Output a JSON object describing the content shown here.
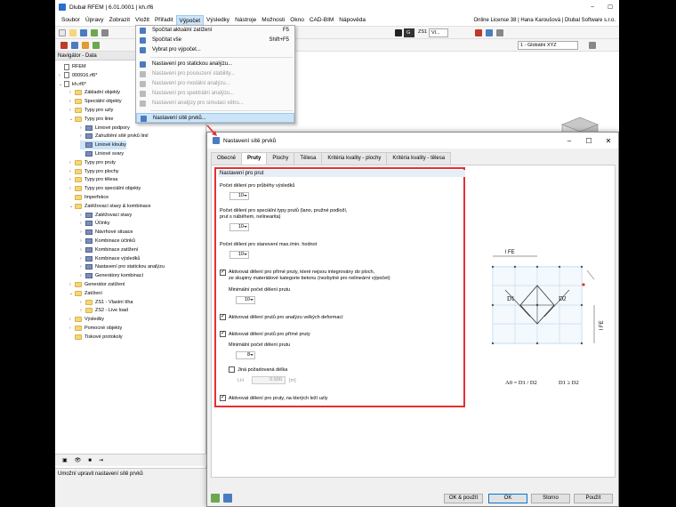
{
  "app": {
    "title": "Dlubal RFEM | 6.01.0001 | kh.rf6",
    "license": "Online License 38 | Hana Karoušová | Dlubal Software s.r.o."
  },
  "menu": [
    "Soubor",
    "Úpravy",
    "Zobrazit",
    "Vložit",
    "Přiřadit",
    "Výpočet",
    "Výsledky",
    "Nástroje",
    "Možnosti",
    "Okno",
    "CAD-BIM",
    "Nápověda"
  ],
  "toolbar": {
    "loadcase_short": "G",
    "loadcase": "ZS1",
    "loadcase_more": "Vl...",
    "coord_system": "1 - Globální XYZ"
  },
  "dropdown": [
    {
      "label": "Spočítat aktuální zatížení",
      "shortcut": "F5",
      "state": "normal"
    },
    {
      "label": "Spočítat vše",
      "shortcut": "Shift+F5",
      "state": "normal"
    },
    {
      "label": "Vybrat pro výpočet...",
      "shortcut": "",
      "state": "normal"
    },
    {
      "label": "Nastavení pro statickou analýzu...",
      "shortcut": "",
      "state": "normal"
    },
    {
      "label": "Nastavení pro posouzení stability...",
      "shortcut": "",
      "state": "disabled"
    },
    {
      "label": "Nastavení pro modální analýzu...",
      "shortcut": "",
      "state": "disabled"
    },
    {
      "label": "Nastavení pro spektrální analýzu...",
      "shortcut": "",
      "state": "disabled"
    },
    {
      "label": "Nastavení analýzy pro simulaci větru...",
      "shortcut": "",
      "state": "disabled"
    },
    {
      "label": "Nastavení sítě prvků...",
      "shortcut": "",
      "state": "highlighted"
    }
  ],
  "navigator": {
    "title": "Navigátor - Data",
    "items": [
      {
        "label": "RFEM",
        "icon": "root",
        "indent": 0,
        "arrow": ""
      },
      {
        "label": "000916.rf6*",
        "icon": "file",
        "indent": 0,
        "arrow": ">"
      },
      {
        "label": "kh.rf6*",
        "icon": "file",
        "indent": 0,
        "arrow": "v"
      },
      {
        "label": "Základní objekty",
        "icon": "folder",
        "indent": 1,
        "arrow": ">"
      },
      {
        "label": "Speciální objekty",
        "icon": "folder",
        "indent": 1,
        "arrow": ">"
      },
      {
        "label": "Typy pro uzly",
        "icon": "folder",
        "indent": 1,
        "arrow": ">"
      },
      {
        "label": "Typy pro linie",
        "icon": "folder",
        "indent": 1,
        "arrow": "v"
      },
      {
        "label": "Liniové podpory",
        "icon": "leaf",
        "indent": 2,
        "arrow": ">"
      },
      {
        "label": "Zahuštění sítě prvků linií",
        "icon": "leaf",
        "indent": 2,
        "arrow": ">"
      },
      {
        "label": "Liniové klouby",
        "icon": "leaf",
        "indent": 2,
        "arrow": "",
        "selected": true
      },
      {
        "label": "Liniové svary",
        "icon": "leaf",
        "indent": 2,
        "arrow": ""
      },
      {
        "label": "Typy pro pruty",
        "icon": "folder",
        "indent": 1,
        "arrow": ">"
      },
      {
        "label": "Typy pro plochy",
        "icon": "folder",
        "indent": 1,
        "arrow": ">"
      },
      {
        "label": "Typy pro tělesa",
        "icon": "folder",
        "indent": 1,
        "arrow": ">"
      },
      {
        "label": "Typy pro speciální objekty",
        "icon": "folder",
        "indent": 1,
        "arrow": ">"
      },
      {
        "label": "Imperfekce",
        "icon": "folder",
        "indent": 1,
        "arrow": ""
      },
      {
        "label": "Zatěžovací stavy & kombinace",
        "icon": "folder",
        "indent": 1,
        "arrow": "v"
      },
      {
        "label": "Zatěžovací stavy",
        "icon": "leaf",
        "indent": 2,
        "arrow": ">"
      },
      {
        "label": "Účinky",
        "icon": "leaf",
        "indent": 2,
        "arrow": ">"
      },
      {
        "label": "Návrhové situace",
        "icon": "leaf",
        "indent": 2,
        "arrow": ">"
      },
      {
        "label": "Kombinace účinků",
        "icon": "leaf",
        "indent": 2,
        "arrow": ">"
      },
      {
        "label": "Kombinace zatížení",
        "icon": "leaf",
        "indent": 2,
        "arrow": ">"
      },
      {
        "label": "Kombinace výsledků",
        "icon": "leaf",
        "indent": 2,
        "arrow": ">"
      },
      {
        "label": "Nastavení pro statickou analýzu",
        "icon": "leaf",
        "indent": 2,
        "arrow": ">"
      },
      {
        "label": "Generátory kombinací",
        "icon": "leaf",
        "indent": 2,
        "arrow": ">"
      },
      {
        "label": "Generátor zatížení",
        "icon": "folder",
        "indent": 1,
        "arrow": ">"
      },
      {
        "label": "Zatížení",
        "icon": "folder",
        "indent": 1,
        "arrow": "v"
      },
      {
        "label": "ZS1 - Vlastní tíha",
        "icon": "folder",
        "indent": 2,
        "arrow": ">"
      },
      {
        "label": "ZS2 - Live load",
        "icon": "folder",
        "indent": 2,
        "arrow": ">"
      },
      {
        "label": "Výsledky",
        "icon": "folder",
        "indent": 1,
        "arrow": ">"
      },
      {
        "label": "Pomocné objekty",
        "icon": "folder",
        "indent": 1,
        "arrow": ">"
      },
      {
        "label": "Tiskové protokoly",
        "icon": "folder",
        "indent": 1,
        "arrow": ""
      }
    ]
  },
  "status": {
    "text": "Umožní upravit nastavení sítě prvků"
  },
  "dialog": {
    "title": "Nastavení sítě prvků",
    "tabs": [
      "Obecné",
      "Pruty",
      "Plochy",
      "Tělesa",
      "Kritéria kvality - plochy",
      "Kritéria kvality - tělesa"
    ],
    "active_tab": "Pruty",
    "section_title": "Nastavení pro prut",
    "fields": {
      "divisions_results_label": "Počet dělení pro průběhy výsledků",
      "divisions_results_value": "10",
      "divisions_special_label_1": "Počet dělení pro speciální typy prutů (lano, pružné podloží,",
      "divisions_special_label_2": "prut s náběhem, nelinearita)",
      "divisions_special_value": "10",
      "divisions_maxmin_label": "Počet dělení pro stanovení max./min. hodnot",
      "divisions_maxmin_value": "10",
      "activate_straight_label_1": "Aktivovat dělení pro přímé pruty, které nejsou integrovány do ploch,",
      "activate_straight_label_2": "ze skupiny materiálové kategorie betonu (nezbytné pro nelineární výpočet)",
      "activate_straight_checked": true,
      "min_divisions_label": "Minimální počet dělení prutu",
      "min_divisions_value": "10",
      "activate_large_def_label": "Aktivovat dělení prutů pro analýzu velkých deformací",
      "activate_large_def_checked": true,
      "activate_straight2_label": "Aktivovat dělení prutů pro přímé pruty",
      "activate_straight2_checked": true,
      "min_divisions2_label": "Minimální počet dělení prutu",
      "min_divisions2_value": "8",
      "other_length_label": "Jiná požadovaná délka",
      "other_length_checked": false,
      "length_prefix": "LH",
      "length_value": "0.500",
      "length_unit": "[m]",
      "activate_surfaces_label": "Aktivovat dělení pro pruty, na kterých leží uzly",
      "activate_surfaces_checked": true
    },
    "diagram": {
      "lfe_top": "l FE",
      "lfe_side": "l FE",
      "d1": "D1",
      "d2": "D2",
      "formula": "A0 = D1 / D2",
      "condition": "D1 ≥ D2"
    },
    "buttons": {
      "ok_apply": "OK & použít",
      "ok": "OK",
      "cancel": "Storno",
      "apply": "Použít"
    }
  },
  "colors": {
    "highlight_box": "#e53030",
    "selection": "#cce4f7",
    "accent": "#0078d7"
  }
}
